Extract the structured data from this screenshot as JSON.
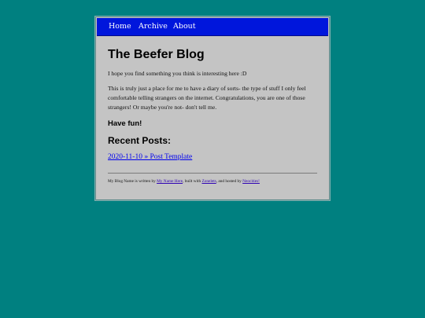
{
  "nav": {
    "home": "Home",
    "archive": "Archive",
    "about": "About"
  },
  "blog": {
    "title": "The Beefer Blog",
    "intro": "I hope you find something you think is interesting here :D",
    "description": "This is truly just a place for me to have a diary of sorts- the type of stuff I only feel comfortable telling strangers on the internet. Congratulations, you are one of those strangers! Or maybe you're not- don't tell me.",
    "have_fun": "Have fun!",
    "recent_heading": "Recent Posts:",
    "recent_posts": [
      {
        "label": "2020-11-10 » Post Template"
      }
    ]
  },
  "footer": {
    "part1": "My Blog Name is written by ",
    "author_link": "My Name Here",
    "part2": ", built with ",
    "built_link": "Zonelets",
    "part3": ", and hosted by ",
    "host_link": "Neocities!"
  },
  "colors": {
    "page_background": "#008080",
    "nav_background": "#0016dc",
    "content_background": "#c4c4c4",
    "link": "#0000ee"
  }
}
